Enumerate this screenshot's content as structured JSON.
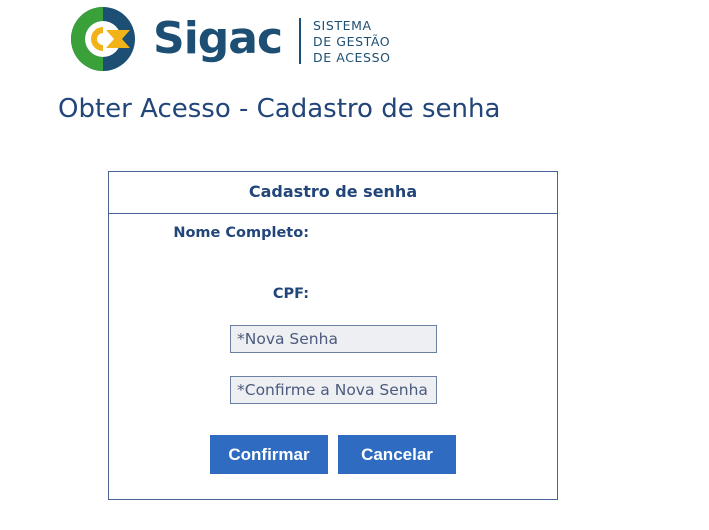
{
  "header": {
    "logo_icon": "sigac-logo-icon",
    "logo_word": "Sigac",
    "tagline_lines": [
      "SISTEMA",
      "DE GESTÃO",
      "DE ACESSO"
    ],
    "colors": {
      "blue": "#1c4f73",
      "green": "#3aa13a",
      "yellow": "#f2b319"
    }
  },
  "page": {
    "title": "Obter Acesso - Cadastro de senha"
  },
  "form": {
    "header": "Cadastro de senha",
    "nome_label": "Nome Completo:",
    "cpf_label": "CPF:",
    "nova_senha": {
      "value": "",
      "placeholder": "*Nova Senha"
    },
    "confirme_senha": {
      "value": "",
      "placeholder": "*Confirme a Nova Senha"
    },
    "confirm_label": "Confirmar",
    "cancel_label": "Cancelar",
    "button_color": "#2f6bc0"
  }
}
